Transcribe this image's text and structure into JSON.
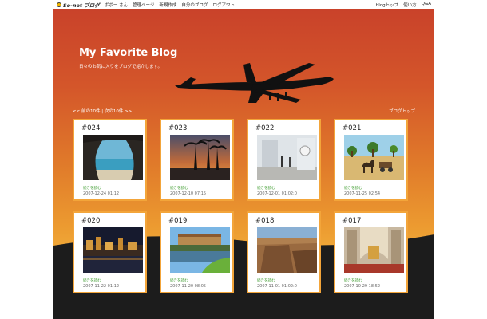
{
  "topbar": {
    "logo_text": "So-net ブログ",
    "nav_left": [
      "ボボー さん",
      "管理ページ",
      "新規作成",
      "自分のブログ",
      "ログアウト"
    ],
    "nav_right": [
      "blogトップ",
      "使い方",
      "Q&A"
    ]
  },
  "header": {
    "title": "My Favorite Blog",
    "subtitle": "日々のお気に入りをブログで紹介します。"
  },
  "pager": {
    "prev": "<< 前の10件",
    "separator": "|",
    "next": "次の10件 >>",
    "blog_top": "ブログトップ"
  },
  "colors": {
    "sky_top": "#c9422a",
    "sky_bottom": "#f5c24a",
    "card_border": "#f3a53a",
    "more_link": "#3a9a2a"
  },
  "cards": [
    {
      "num": "#024",
      "more": "続きを読む",
      "date": "2007-12-24 01:12",
      "photo": "beach-cave"
    },
    {
      "num": "#023",
      "more": "続きを読む",
      "date": "2007-12-10 07:15",
      "photo": "palm-sunset"
    },
    {
      "num": "#022",
      "more": "続きを読む",
      "date": "2007-12-01 01:02:0",
      "photo": "ship-deck"
    },
    {
      "num": "#021",
      "more": "続きを読む",
      "date": "2007-11-25 02:54",
      "photo": "camel-desert"
    },
    {
      "num": "#020",
      "more": "続きを読む",
      "date": "2007-11-22 01:12",
      "photo": "night-town"
    },
    {
      "num": "#019",
      "more": "続きを読む",
      "date": "2007-11-20 08:05",
      "photo": "river-bridge"
    },
    {
      "num": "#018",
      "more": "続きを読む",
      "date": "2007-11-01 01:02:0",
      "photo": "canyon"
    },
    {
      "num": "#017",
      "more": "続きを読む",
      "date": "2007-10-29 18:52",
      "photo": "cathedral"
    }
  ]
}
